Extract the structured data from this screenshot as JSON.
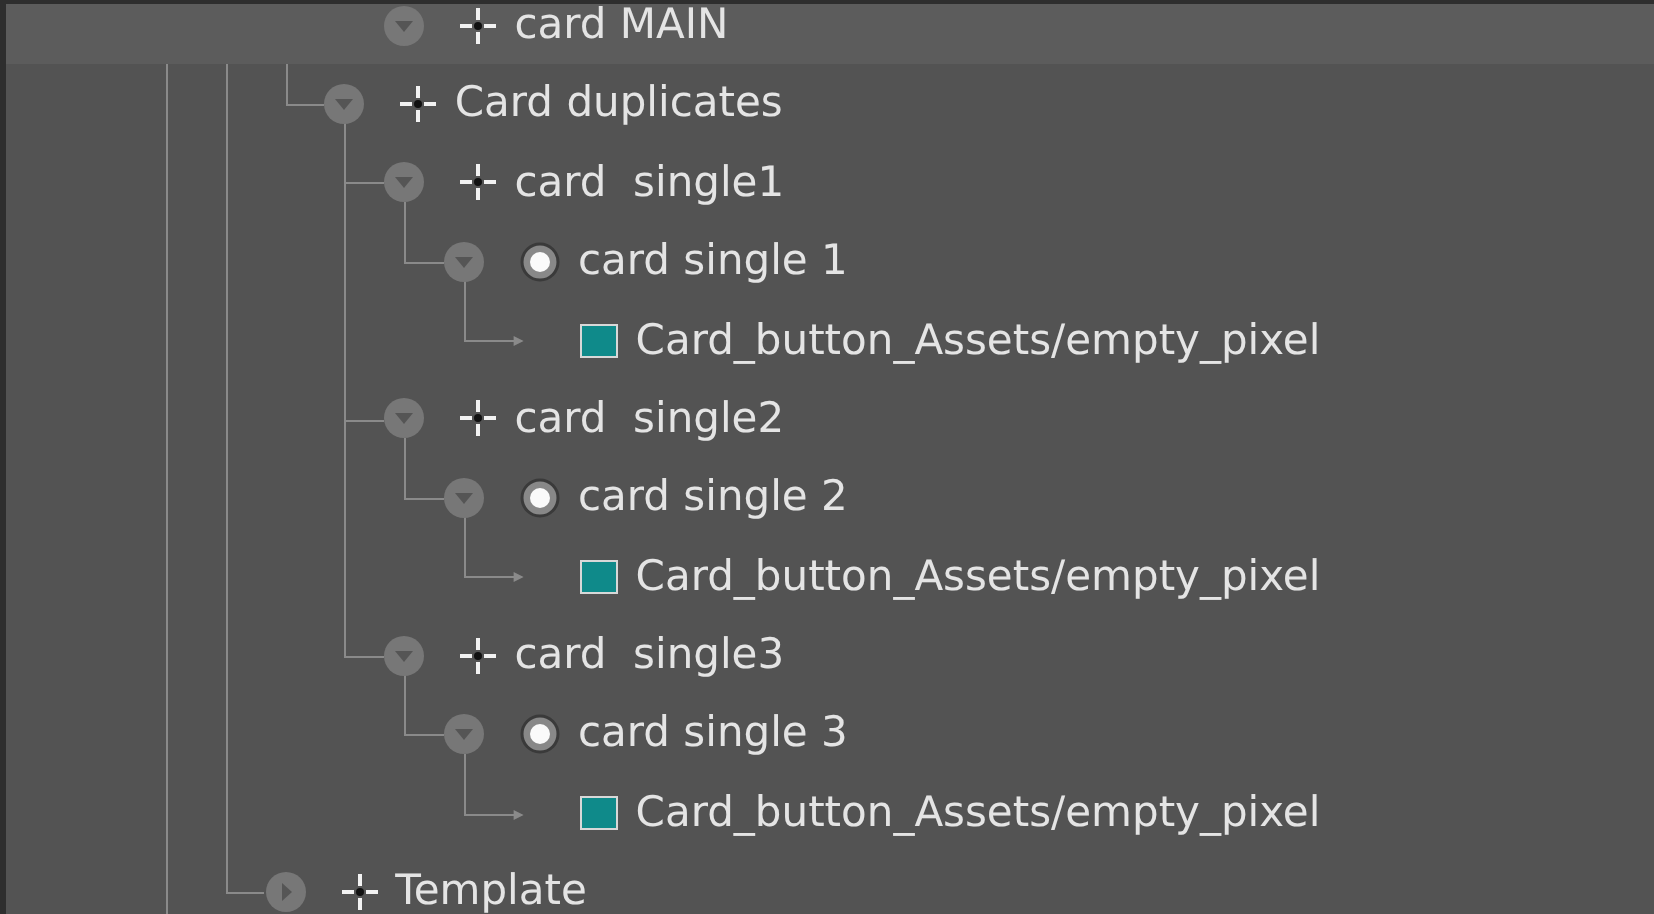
{
  "tree": [
    {
      "children": [
        {
          "children": [
            {
              "children": [
                {
                  "children": [
                    {
                      "label": "card MAIN",
                      "kind": "group",
                      "expanded": true,
                      "selected": true
                    }
                  ]
                },
                {
                  "label": "Card duplicates",
                  "kind": "group",
                  "expanded": true,
                  "selected": false,
                  "children": [
                    {
                      "label": "card  single1",
                      "kind": "group",
                      "expanded": true,
                      "selected": false,
                      "children": [
                        {
                          "label": "card single 1",
                          "kind": "button",
                          "expanded": true,
                          "selected": false,
                          "children": [
                            {
                              "label": "Card_button_Assets/empty_pixel",
                              "kind": "image",
                              "selected": false
                            }
                          ]
                        }
                      ]
                    },
                    {
                      "label": "card  single2",
                      "kind": "group",
                      "expanded": true,
                      "selected": false,
                      "children": [
                        {
                          "label": "card single 2",
                          "kind": "button",
                          "expanded": true,
                          "selected": false,
                          "children": [
                            {
                              "label": "Card_button_Assets/empty_pixel",
                              "kind": "image",
                              "selected": false
                            }
                          ]
                        }
                      ]
                    },
                    {
                      "label": "card  single3",
                      "kind": "group",
                      "expanded": true,
                      "selected": false,
                      "children": [
                        {
                          "label": "card single 3",
                          "kind": "button",
                          "expanded": true,
                          "selected": false,
                          "children": [
                            {
                              "label": "Card_button_Assets/empty_pixel",
                              "kind": "image",
                              "selected": false
                            }
                          ]
                        }
                      ]
                    }
                  ]
                }
              ]
            },
            {
              "label": "Template",
              "kind": "group",
              "expanded": false,
              "selected": false
            }
          ]
        }
      ]
    }
  ]
}
